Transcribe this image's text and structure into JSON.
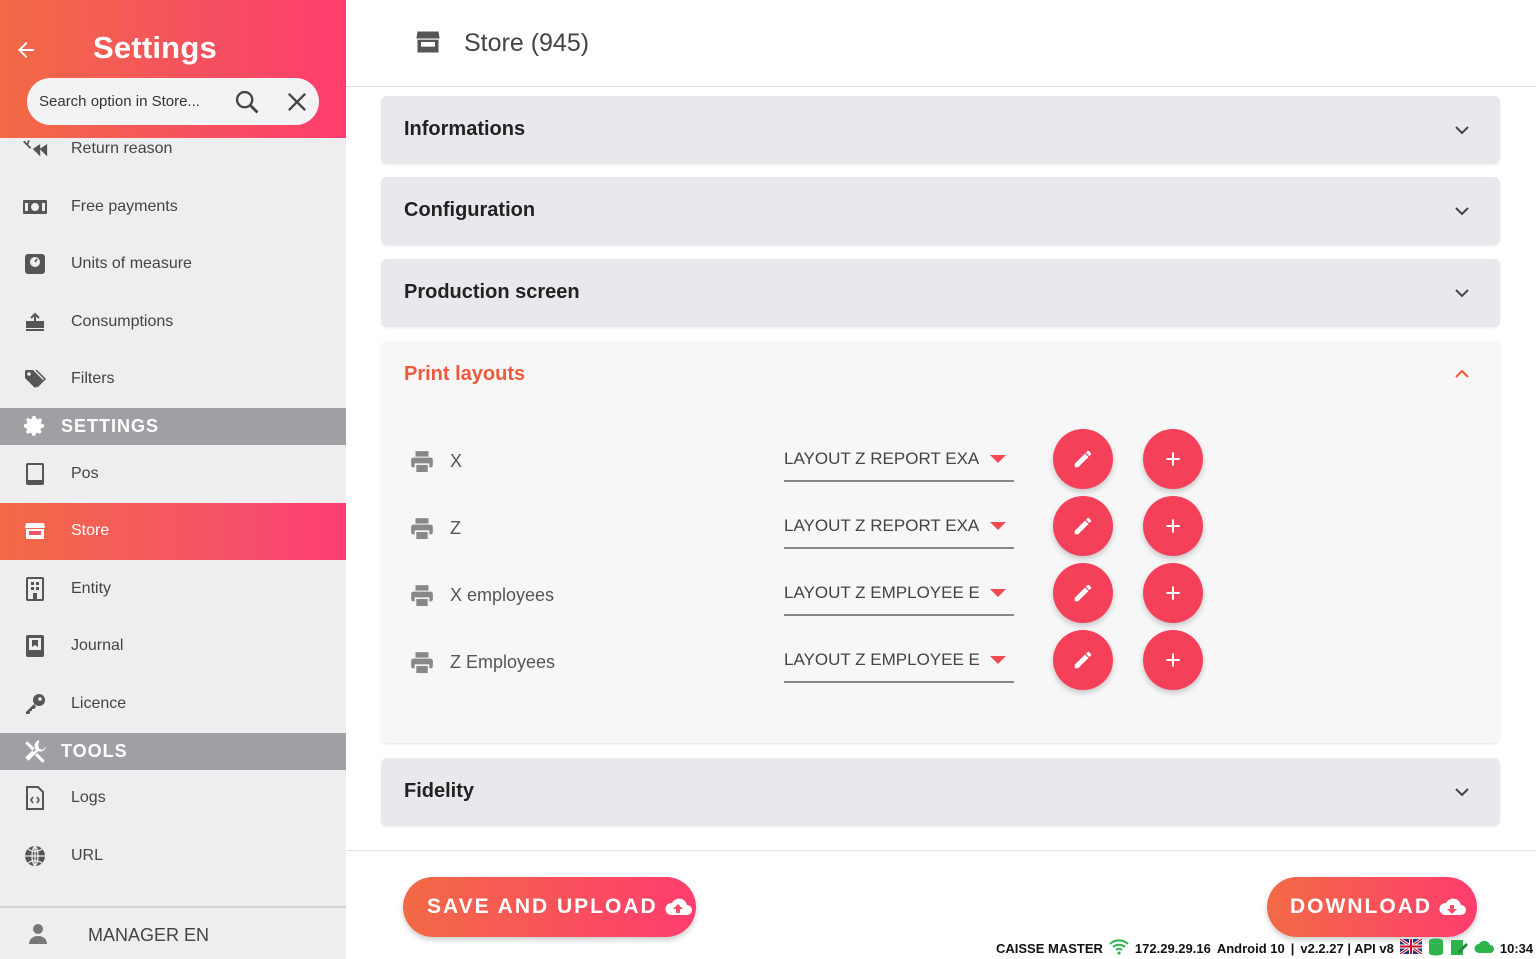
{
  "sidebar": {
    "title": "Settings",
    "search_placeholder": "Search option in Store...",
    "items": [
      {
        "label": "Return reason",
        "icon": "return-reason-icon"
      },
      {
        "label": "Free payments",
        "icon": "cash-icon"
      },
      {
        "label": "Units of measure",
        "icon": "scale-icon"
      },
      {
        "label": "Consumptions",
        "icon": "consumption-icon"
      },
      {
        "label": "Filters",
        "icon": "tags-icon"
      }
    ],
    "settings_header": "SETTINGS",
    "settings_items": [
      {
        "label": "Pos",
        "icon": "tablet-icon"
      },
      {
        "label": "Store",
        "icon": "store-icon",
        "active": true
      },
      {
        "label": "Entity",
        "icon": "building-icon"
      },
      {
        "label": "Journal",
        "icon": "journal-icon"
      },
      {
        "label": "Licence",
        "icon": "key-icon"
      }
    ],
    "tools_header": "TOOLS",
    "tools_items": [
      {
        "label": "Logs",
        "icon": "file-code-icon"
      },
      {
        "label": "URL",
        "icon": "globe-icon"
      }
    ],
    "user": "MANAGER EN"
  },
  "header": {
    "title": "Store (945)"
  },
  "panels": {
    "informations": "Informations",
    "configuration": "Configuration",
    "production": "Production screen",
    "print_layouts": "Print layouts",
    "fidelity": "Fidelity"
  },
  "print_layouts": [
    {
      "name": "X",
      "layout": "LAYOUT Z REPORT EXAM..."
    },
    {
      "name": "Z",
      "layout": "LAYOUT Z REPORT EXAM..."
    },
    {
      "name": "X employees",
      "layout": "LAYOUT Z EMPLOYEE EX..."
    },
    {
      "name": "Z Employees",
      "layout": "LAYOUT Z EMPLOYEE EX..."
    }
  ],
  "footer": {
    "save_label": "SAVE AND UPLOAD",
    "download_label": "DOWNLOAD"
  },
  "status": {
    "app": "CAISSE MASTER",
    "ip": "172.29.29.16",
    "os": "Android 10",
    "version": "v2.2.27 | API v8",
    "time": "10:34"
  },
  "colors": {
    "accent_start": "#f26a45",
    "accent_end": "#ff3d6e",
    "print_title": "#f05a3a",
    "button": "#f5405a"
  }
}
